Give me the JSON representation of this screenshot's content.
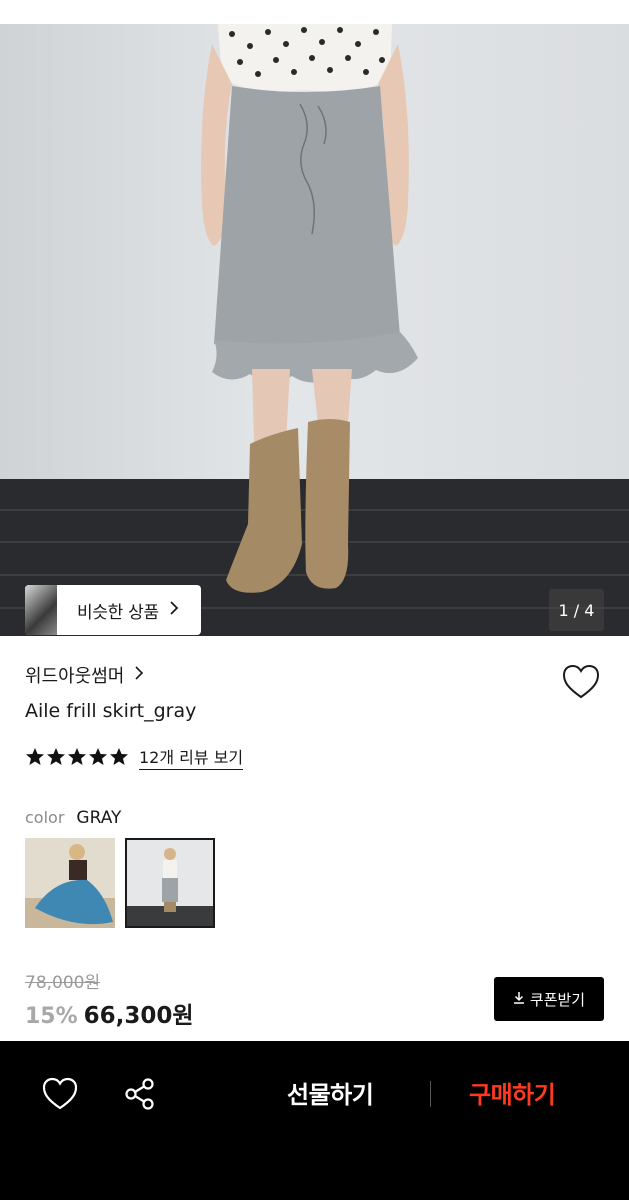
{
  "gallery": {
    "similar_label": "비슷한 상품",
    "page_indicator": "1 / 4"
  },
  "product": {
    "brand": "위드아웃썸머",
    "name": "Aile frill skirt_gray",
    "rating_stars": 5,
    "review_link": "12개 리뷰 보기",
    "color_label": "color",
    "color_value": "GRAY",
    "original_price": "78,000원",
    "discount": "15%",
    "sale_price": "66,300원",
    "coupon_label": "쿠폰받기"
  },
  "bottom_bar": {
    "gift_label": "선물하기",
    "buy_label": "구매하기"
  },
  "icons": [
    "chevron-right-icon",
    "heart-icon",
    "star-icon",
    "download-icon",
    "share-icon"
  ],
  "colors": {
    "buy_accent": "#ff3a1f",
    "bar_background": "#000000",
    "discount_gray": "#a8a8a8"
  }
}
